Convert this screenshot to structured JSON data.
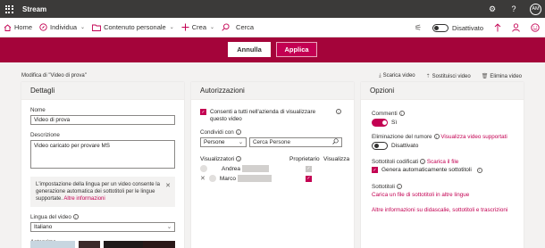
{
  "app": {
    "title": "Stream"
  },
  "user": {
    "initials": "AM"
  },
  "nav": {
    "home": "Home",
    "individua": "Individua",
    "contenuto": "Contenuto personale",
    "crea": "Crea",
    "search": "Cerca",
    "toggle_label": "Disattivato"
  },
  "band": {
    "cancel": "Annulla",
    "apply": "Applica"
  },
  "page": {
    "subtitle": "Modifica di \"Video di prova\"",
    "actions": [
      "Scarica video",
      "Sostituisci video",
      "Elimina video"
    ]
  },
  "details": {
    "heading": "Dettagli",
    "title_label": "Nome",
    "title_value": "Video di prova",
    "desc_label": "Descrizione",
    "desc_value": "Video caricato per provare MS",
    "info_text": "L'impostazione della lingua per un video consente la generazione automatica dei sottotitoli per le lingue supportate.",
    "info_link": "Altre informazioni",
    "lang_label": "Lingua del video",
    "lang_value": "Italiano",
    "thumb_label": "Anteprima"
  },
  "permissions": {
    "heading": "Autorizzazioni",
    "allow_text": "Consenti a tutti nell'azienda di visualizzare questo video",
    "share_label": "Condividi con",
    "share_select": "Persone",
    "share_placeholder": "Cerca Persone",
    "viewers_label": "Visualizzatori",
    "owner_label": "Proprietario",
    "view_label": "Visualizza",
    "people": [
      "Andrea",
      "Marco"
    ]
  },
  "options": {
    "heading": "Opzioni",
    "comments_label": "Commenti",
    "comments_value": "Sì",
    "noise_label": "Eliminazione del rumore",
    "noise_link": "Visualizza video supportati",
    "noise_value": "Disattivato",
    "autocap_label": "Sottotitoli codificati",
    "autocap_link": "Scarica il file",
    "autocap_check": "Genera automaticamente sottotitoli",
    "subs_label": "Sottotitoli",
    "subs_link": "Carica un file di sottotitoli in altre lingue",
    "more_link": "Altre informazioni su didascalie, sottotitoli e trascrizioni"
  },
  "colors": {
    "accent": "#c30052",
    "band": "#a4043a",
    "suitebar": "#3b3a39"
  }
}
